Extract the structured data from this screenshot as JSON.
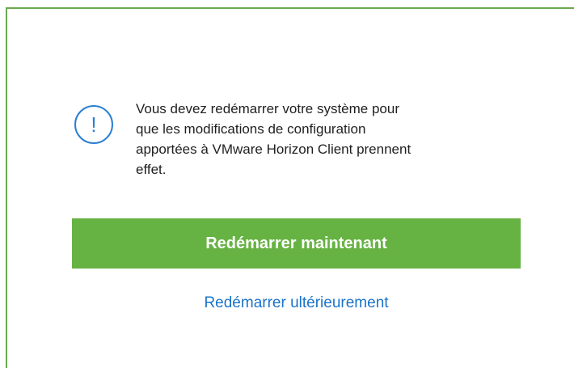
{
  "dialog": {
    "message": "Vous devez redémarrer votre système pour\nque les modifications de configuration\napportées à VMware Horizon Client prennent\neffet.",
    "info_icon": "info-exclamation-icon",
    "icon_glyph": "!",
    "primary_button_label": "Redémarrer maintenant",
    "secondary_link_label": "Redémarrer ultérieurement"
  },
  "colors": {
    "frame": "#6aa84f",
    "primary_button": "#66b243",
    "icon": "#2b7fd4",
    "link": "#1a73c9"
  }
}
